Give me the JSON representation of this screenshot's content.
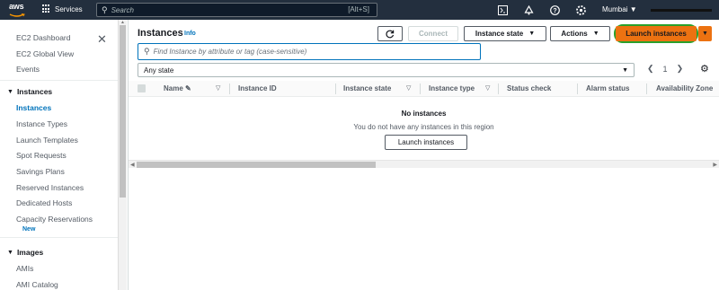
{
  "topbar": {
    "logo_text": "aws",
    "services_label": "Services",
    "search_placeholder": "Search",
    "search_shortcut": "[Alt+S]",
    "region": "Mumbai",
    "icons": [
      "cloudshell-icon",
      "bell-icon",
      "help-icon",
      "gear-icon"
    ]
  },
  "sidebar": {
    "top_items": [
      "EC2 Dashboard",
      "EC2 Global View",
      "Events"
    ],
    "instances_heading": "Instances",
    "instances_items": [
      "Instances",
      "Instance Types",
      "Launch Templates",
      "Spot Requests",
      "Savings Plans",
      "Reserved Instances",
      "Dedicated Hosts",
      "Capacity Reservations"
    ],
    "new_badge": "New",
    "images_heading": "Images",
    "images_items": [
      "AMIs",
      "AMI Catalog"
    ],
    "active": "Instances"
  },
  "main": {
    "title": "Instances",
    "info": "Info",
    "connect_label": "Connect",
    "instance_state_label": "Instance state",
    "actions_label": "Actions",
    "launch_label": "Launch instances",
    "filter_placeholder": "Find Instance by attribute or tag (case-sensitive)",
    "state_filter": "Any state",
    "page_number": "1",
    "columns": [
      "Name",
      "Instance ID",
      "Instance state",
      "Instance type",
      "Status check",
      "Alarm status",
      "Availability Zone"
    ],
    "empty_title": "No instances",
    "empty_desc": "You do not have any instances in this region",
    "empty_button": "Launch instances"
  },
  "colors": {
    "header_bg": "#232f3e",
    "primary_button": "#ec7211",
    "link": "#0073bb",
    "highlight_ring": "#2aa02a"
  }
}
